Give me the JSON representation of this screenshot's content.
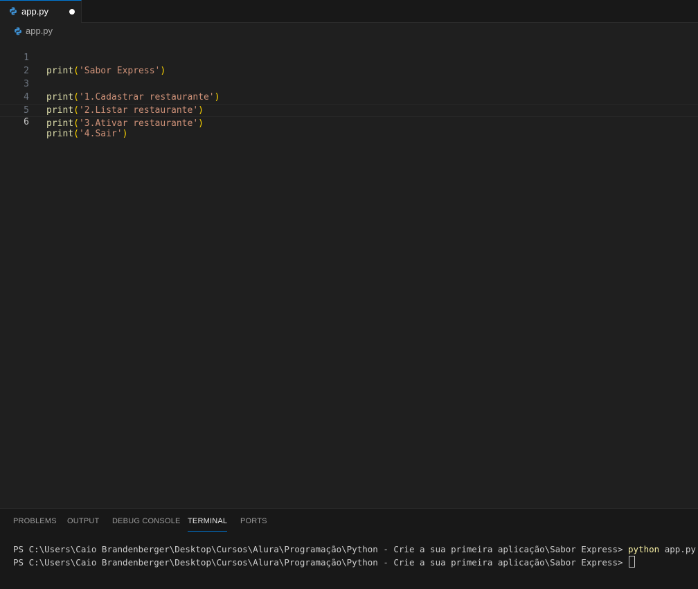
{
  "tab": {
    "label": "app.py",
    "icon": "python-icon"
  },
  "breadcrumb": {
    "label": "app.py",
    "icon": "python-icon"
  },
  "editor": {
    "current_line": 6,
    "lines": [
      {
        "number": "1",
        "fn": "print",
        "arg": "'Sabor Express'"
      },
      {
        "number": "2"
      },
      {
        "number": "3",
        "fn": "print",
        "arg": "'1.Cadastrar restaurante'"
      },
      {
        "number": "4",
        "fn": "print",
        "arg": "'2.Listar restaurante'"
      },
      {
        "number": "5",
        "fn": "print",
        "arg": "'3.Ativar restaurante'"
      },
      {
        "number": "6",
        "fn": "print",
        "arg": "'4.Sair'"
      }
    ]
  },
  "panel": {
    "tabs": [
      "PROBLEMS",
      "OUTPUT",
      "DEBUG CONSOLE",
      "TERMINAL",
      "PORTS"
    ],
    "active_tab": "TERMINAL"
  },
  "terminal": {
    "prompt": "PS C:\\Users\\Caio Brandenberger\\Desktop\\Cursos\\Alura\\Programação\\Python - Crie a sua primeira aplicação\\Sabor Express> ",
    "command_name": "python",
    "command_args": " app.py"
  },
  "colors": {
    "accent": "#0078d4",
    "function": "#dcdcaa",
    "string": "#ce9178",
    "bracket": "#ffd700",
    "command": "#f9f1a5"
  }
}
